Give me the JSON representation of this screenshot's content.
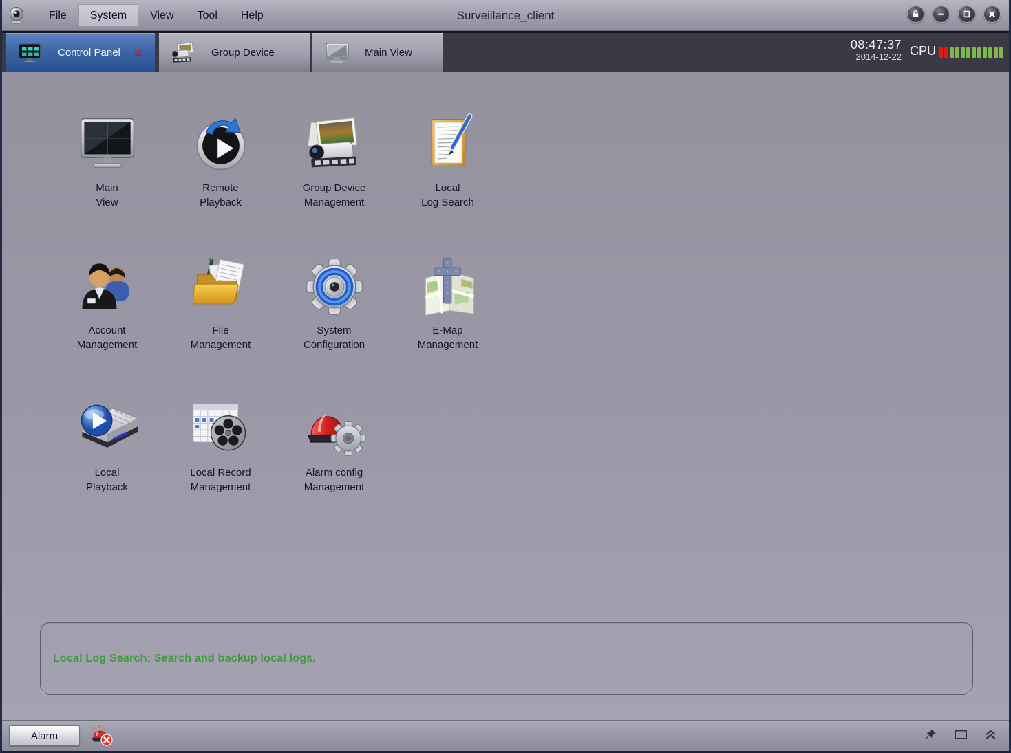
{
  "titlebar": {
    "title": "Surveillance_client",
    "menu_items": [
      "File",
      "System",
      "View",
      "Tool",
      "Help"
    ],
    "active_menu": "System",
    "window_controls": [
      "lock",
      "minimize",
      "maximize",
      "close"
    ]
  },
  "tabbar": {
    "tabs": [
      {
        "label": "Control Panel",
        "active": true,
        "closable": true
      },
      {
        "label": "Group Device",
        "active": false
      },
      {
        "label": "Main View",
        "active": false
      }
    ],
    "clock": {
      "time": "08:47:37",
      "date": "2014-12-22"
    },
    "cpu": {
      "label": "CPU",
      "segments": [
        "red",
        "red",
        "green",
        "green",
        "green",
        "green",
        "green",
        "green",
        "green",
        "green",
        "green",
        "green"
      ]
    }
  },
  "launcher": {
    "items": [
      {
        "line1": "Main",
        "line2": "View"
      },
      {
        "line1": "Remote",
        "line2": "Playback"
      },
      {
        "line1": "Group Device",
        "line2": "Management"
      },
      {
        "line1": "Local",
        "line2": "Log Search"
      },
      {
        "line1": "Account",
        "line2": "Management"
      },
      {
        "line1": "File",
        "line2": "Management"
      },
      {
        "line1": "System",
        "line2": "Configuration"
      },
      {
        "line1": "E-Map",
        "line2": "Management"
      },
      {
        "line1": "Local",
        "line2": "Playback"
      },
      {
        "line1": "Local Record",
        "line2": "Management"
      },
      {
        "line1": "Alarm config",
        "line2": "Management"
      }
    ]
  },
  "description": {
    "text": "Local Log Search: Search and backup local logs."
  },
  "statusbar": {
    "alarm_label": "Alarm"
  },
  "colors": {
    "active_tab_blue": "#2f5694",
    "tabbar_dark": "#3a3944",
    "description_green": "#3f9a3f",
    "cpu_red": "#e11a1a",
    "cpu_green": "#7fb94e"
  }
}
